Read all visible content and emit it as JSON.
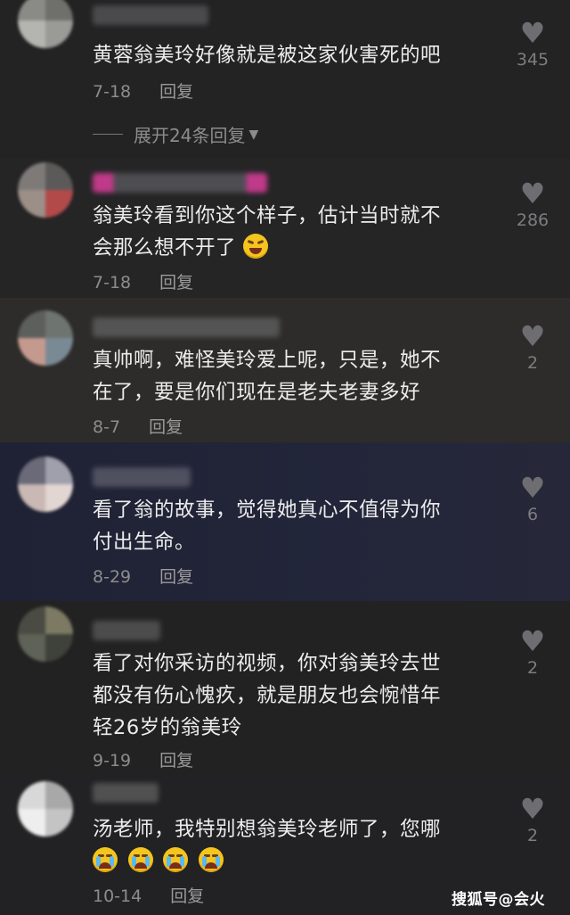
{
  "comments": [
    {
      "text": "黄蓉翁美玲好像就是被这家伙害死的吧",
      "date": "7-18",
      "reply": "回复",
      "likes": "345"
    },
    {
      "text_line1": "翁美玲看到你这个样子，估计当时就不",
      "text_line2": "会那么想不开了",
      "date": "7-18",
      "reply": "回复",
      "likes": "286",
      "emoji": "laughing-tears-emoji"
    },
    {
      "text_line1": "真帅啊，难怪美玲爱上呢，只是，她不",
      "text_line2": "在了，要是你们现在是老夫老妻多好",
      "date": "8-7",
      "reply": "回复",
      "likes": "2"
    },
    {
      "text_line1": "看了翁的故事，觉得她真心不值得为你",
      "text_line2": "付出生命。",
      "date": "8-29",
      "reply": "回复",
      "likes": "6"
    },
    {
      "text_line1": "看了对你采访的视频，你对翁美玲去世",
      "text_line2": "都没有伤心愧疚，就是朋友也会惋惜年",
      "text_line3": "轻26岁的翁美玲",
      "date": "9-19",
      "reply": "回复",
      "likes": "2"
    },
    {
      "text": "汤老师，我特别想翁美玲老师了，您哪",
      "date": "10-14",
      "reply": "回复",
      "likes": "2",
      "emoji": "crying-emoji"
    }
  ],
  "expand_replies": "展开24条回复",
  "watermark": "搜狐号@会火",
  "colors": {
    "heart": "#6e6e72",
    "text": "#ececec",
    "meta": "#8c8c8c"
  }
}
